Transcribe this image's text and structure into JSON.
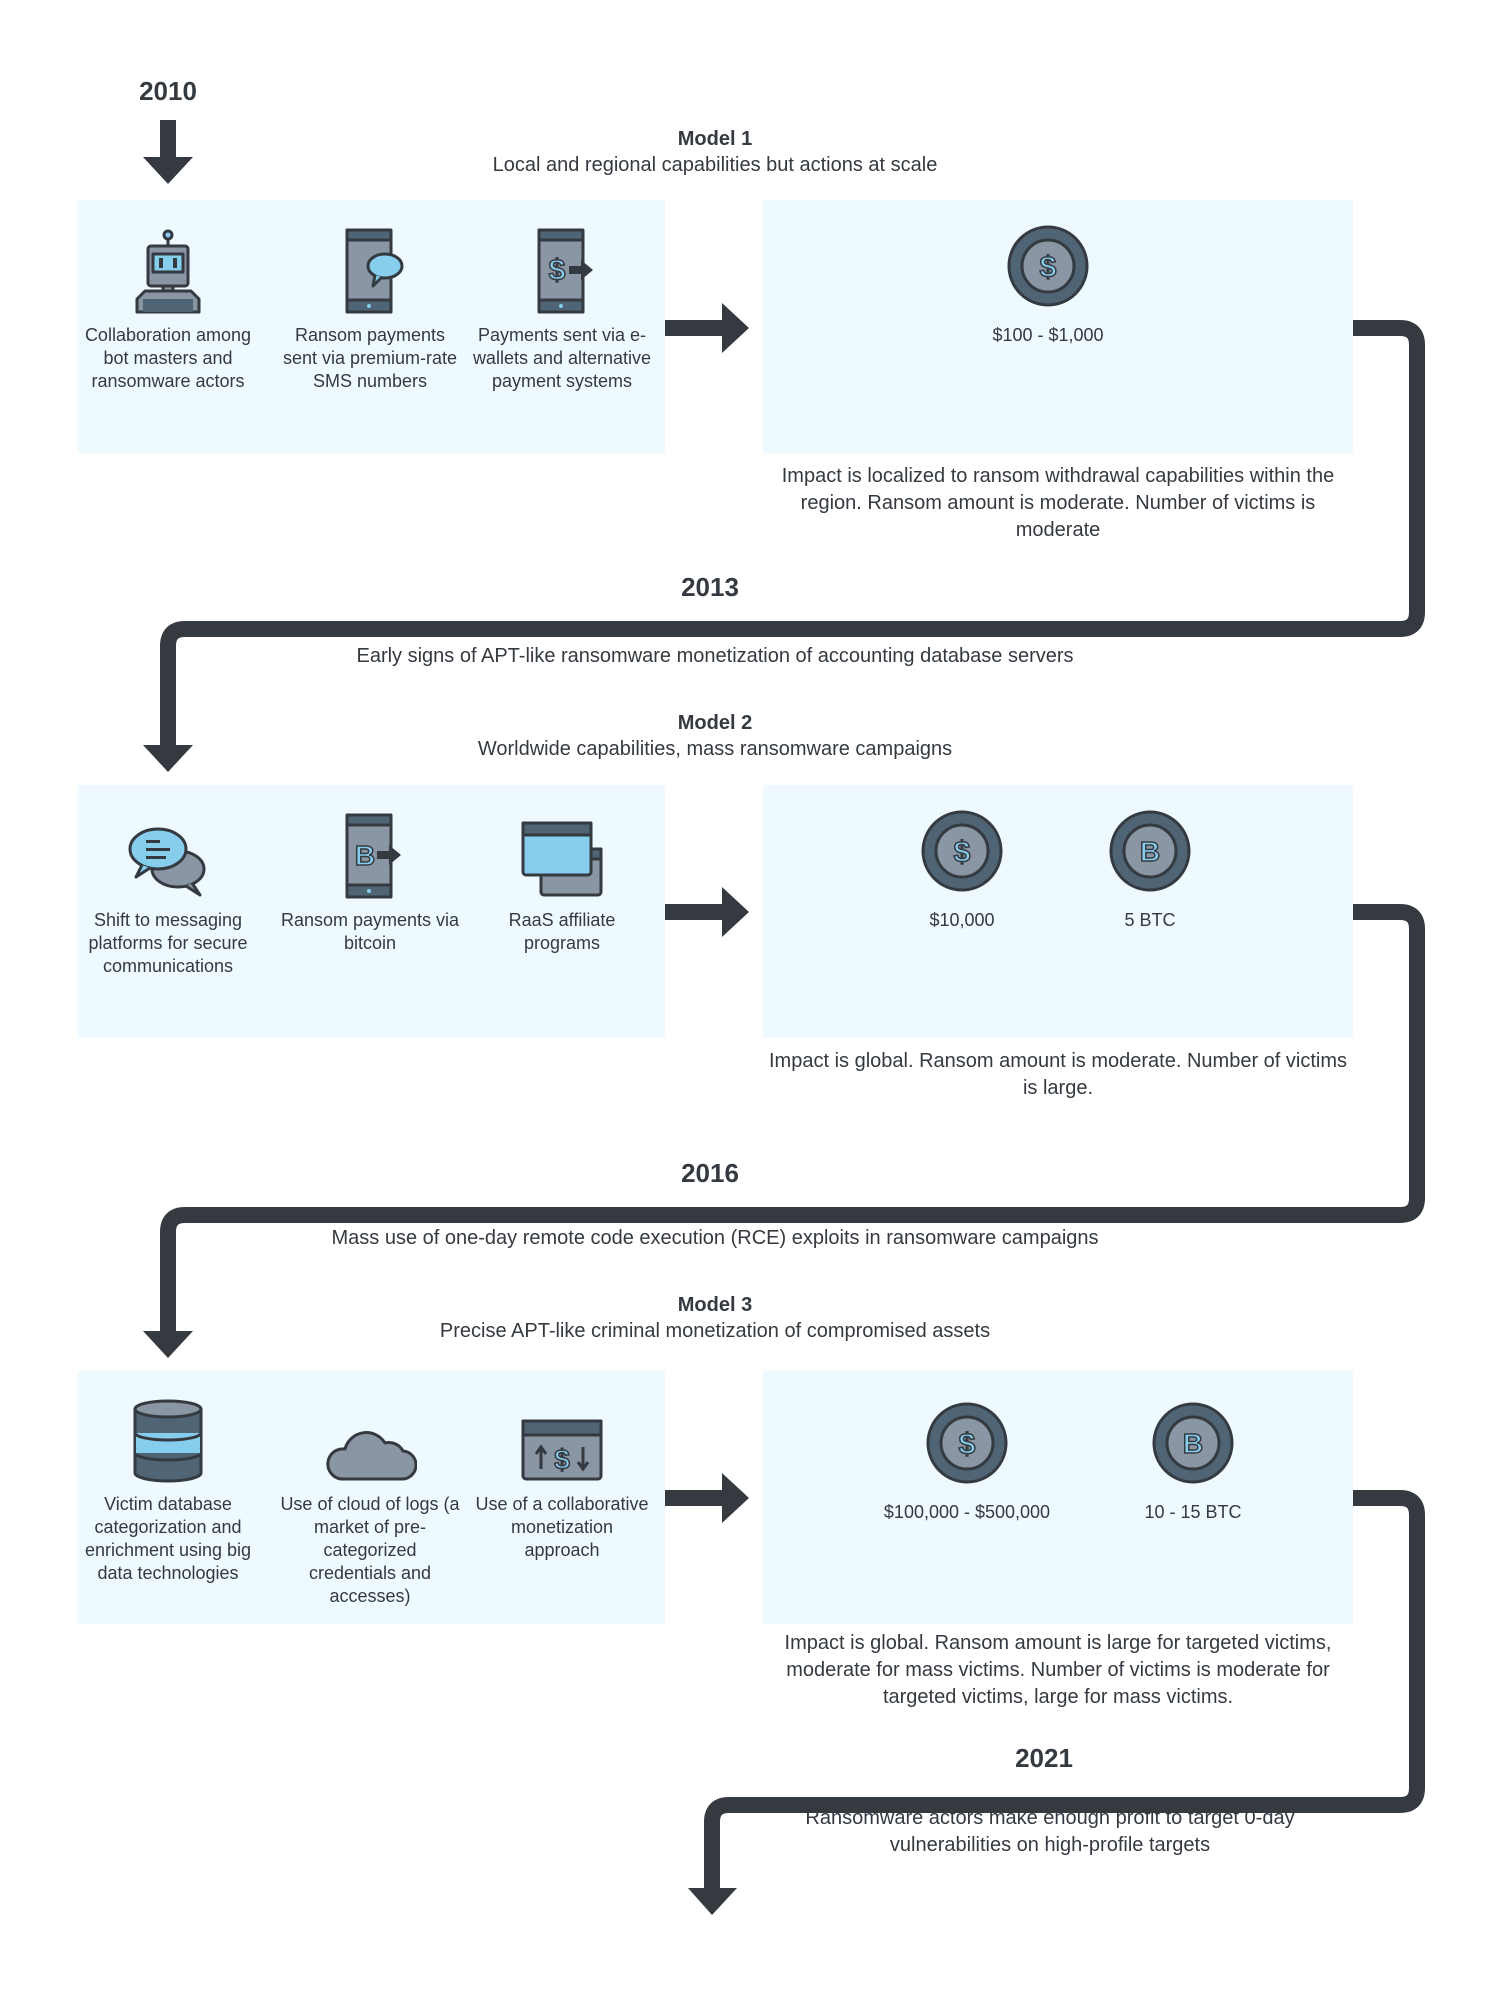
{
  "colors": {
    "dark": "#343a40",
    "panel_bg": "#eefaff",
    "icon_grey": "#8a96a3",
    "icon_slate": "#4f6475",
    "icon_light_blue": "#87cdee"
  },
  "timeline": [
    {
      "year": "2010",
      "model": {
        "title": "Model 1",
        "subtitle": "Local and regional capabilities but actions at scale",
        "features": [
          {
            "icon": "robot-icon",
            "label": "Collaboration among bot masters and ransomware actors"
          },
          {
            "icon": "phone-sms-icon",
            "label": "Ransom payments sent via premium-rate SMS numbers"
          },
          {
            "icon": "phone-dollar-transfer-icon",
            "label": "Payments sent via e-wallets and alternative payment systems"
          }
        ],
        "amounts": [
          {
            "icon": "dollar-coin-icon",
            "label": "$100 - $1,000"
          }
        ],
        "impact": "Impact is localized to ransom withdrawal capabilities within the region. Ransom amount is moderate. Number of victims is moderate"
      }
    },
    {
      "year": "2013",
      "transition_note": "Early signs of APT-like ransomware monetization of accounting database servers",
      "model": {
        "title": "Model 2",
        "subtitle": "Worldwide capabilities, mass ransomware campaigns",
        "features": [
          {
            "icon": "chat-bubbles-icon",
            "label": "Shift to messaging platforms for secure communications"
          },
          {
            "icon": "phone-bitcoin-transfer-icon",
            "label": "Ransom payments via bitcoin"
          },
          {
            "icon": "windows-icon",
            "label": "RaaS affiliate programs"
          }
        ],
        "amounts": [
          {
            "icon": "dollar-coin-icon",
            "label": "$10,000"
          },
          {
            "icon": "bitcoin-coin-icon",
            "label": "5 BTC"
          }
        ],
        "impact": "Impact is global. Ransom amount is moderate. Number of victims is large."
      }
    },
    {
      "year": "2016",
      "transition_note": "Mass use of one-day remote code execution (RCE) exploits in ransomware campaigns",
      "model": {
        "title": "Model 3",
        "subtitle": "Precise APT-like criminal monetization of compromised assets",
        "features": [
          {
            "icon": "database-icon",
            "label": "Victim database categorization and enrichment using big data technologies"
          },
          {
            "icon": "cloud-icon",
            "label": "Use of cloud of logs (a market of pre-categorized credentials and accesses)"
          },
          {
            "icon": "money-exchange-window-icon",
            "label": "Use of a collaborative monetization approach"
          }
        ],
        "amounts": [
          {
            "icon": "dollar-coin-icon",
            "label": "$100,000 - $500,000"
          },
          {
            "icon": "bitcoin-coin-icon",
            "label": "10 - 15 BTC"
          }
        ],
        "impact": "Impact is global. Ransom amount is large for targeted victims, moderate for mass victims. Number of victims is moderate for targeted victims, large for mass victims."
      }
    },
    {
      "year": "2021",
      "transition_note": "Ransomware actors make enough profit to target 0-day vulnerabilities on high-profile targets"
    }
  ]
}
